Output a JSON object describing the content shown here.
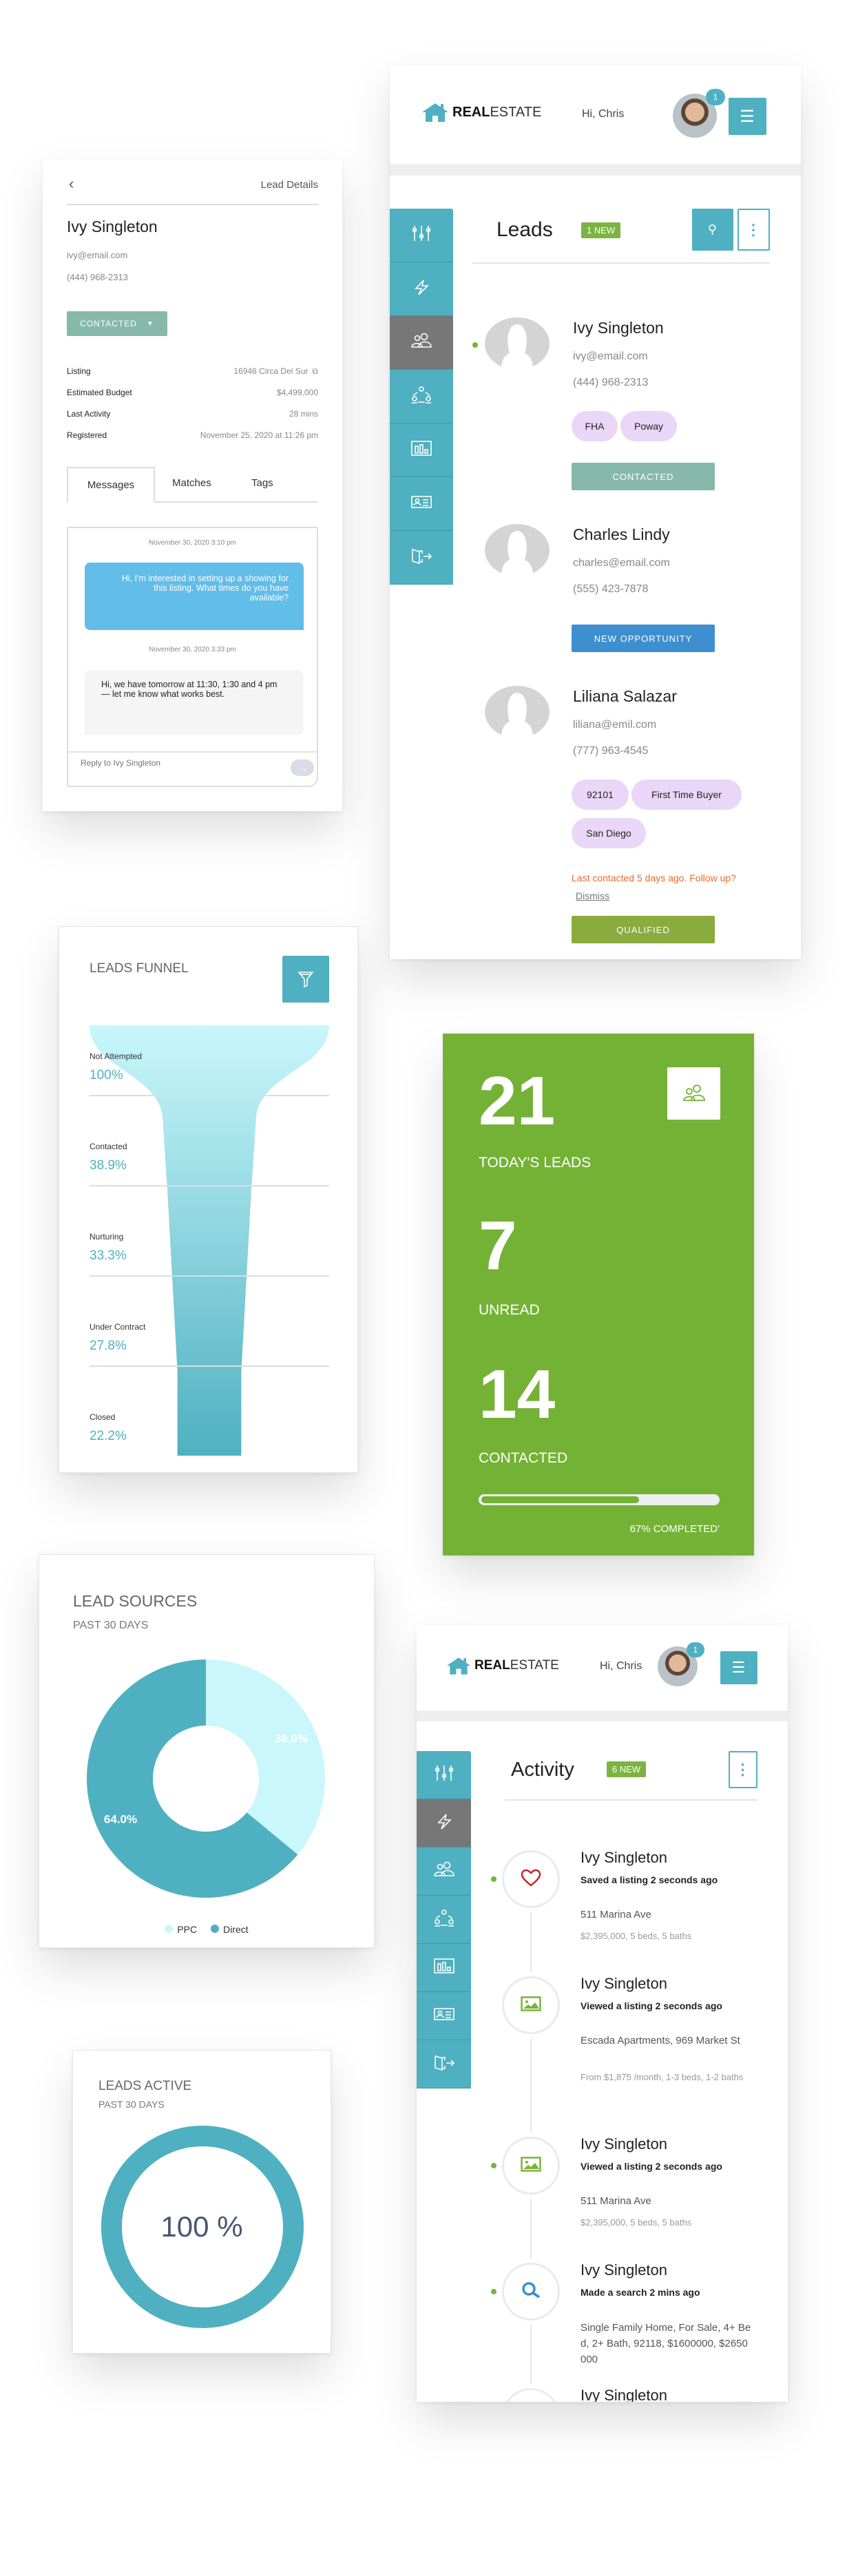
{
  "lead_details": {
    "title": "Lead Details",
    "name": "Ivy Singleton",
    "email": "ivy@email.com",
    "phone": "(444) 968-2313",
    "status": "CONTACTED",
    "fields": [
      {
        "label": "Listing",
        "value": "16946 Circa Del Sur"
      },
      {
        "label": "Estimated Budget",
        "value": "$4,499,000"
      },
      {
        "label": "Last Activity",
        "value": "28 mins"
      },
      {
        "label": "Registered",
        "value": "November 25, 2020 at 11:26 pm"
      }
    ],
    "tabs": [
      "Messages",
      "Matches",
      "Tags"
    ],
    "active_tab": "Messages",
    "messages": [
      {
        "time": "November 30, 2020 3:10 pm",
        "text": "Hi, I'm interested in setting up a showing for this listing. What times do you have available?",
        "outgoing": true
      },
      {
        "time": "November 30, 2020 3:33 pm",
        "text": "Hi, we have tomorrow at 11:30, 1:30 and 4 pm — let me know what works best.",
        "outgoing": false
      }
    ],
    "reply_placeholder": "Reply to Ivy Singleton"
  },
  "header": {
    "logo_bold": "REAL",
    "logo_light": "ESTATE",
    "greeting": "Hi, Chris",
    "notification_count": "1"
  },
  "sidebar_icons": [
    "sliders-icon",
    "bolt-icon",
    "users-icon",
    "network-icon",
    "chart-icon",
    "id-card-icon",
    "logout-icon"
  ],
  "leads": {
    "title": "Leads",
    "badge": "1 NEW",
    "items": [
      {
        "name": "Ivy Singleton",
        "email": "ivy@email.com",
        "phone": "(444) 968-2313",
        "tags": [
          "FHA",
          "Poway"
        ],
        "status": "CONTACTED",
        "status_color": "#86b9a9",
        "unread": true
      },
      {
        "name": "Charles Lindy",
        "email": "charles@email.com",
        "phone": "(555) 423-7878",
        "tags": [],
        "status": "NEW OPPORTUNITY",
        "status_color": "#3e8fd0",
        "unread": false
      },
      {
        "name": "Liliana Salazar",
        "email": "liliana@emil.com",
        "phone": "(777) 963-4545",
        "tags": [
          "92101",
          "First Time Buyer",
          "San Diego"
        ],
        "warning": "Last contacted 5 days ago. Follow up?",
        "dismiss": "Dismiss",
        "status": "QUALIFIED",
        "status_color": "#8aab3e",
        "unread": false
      }
    ]
  },
  "funnel": {
    "title": "LEADS FUNNEL",
    "chart_data": {
      "type": "funnel",
      "categories": [
        "Not Attempted",
        "Contacted",
        "Nurturing",
        "Under Contract",
        "Closed"
      ],
      "values": [
        100,
        38.9,
        33.3,
        27.8,
        22.2
      ],
      "labels": [
        "100%",
        "38.9%",
        "33.3%",
        "27.8%",
        "22.2%"
      ],
      "colors": [
        "#c9f7fb",
        "#4fb0c1"
      ]
    }
  },
  "stats": {
    "todays_leads": "21",
    "todays_leads_label": "TODAY'S LEADS",
    "unread": "7",
    "unread_label": "UNREAD",
    "contacted": "14",
    "contacted_label": "CONTACTED",
    "progress": 0.67,
    "progress_label": "67% COMPLETED'",
    "color": "#74b236"
  },
  "lead_sources": {
    "title": "LEAD SOURCES",
    "subtitle": "PAST 30 DAYS",
    "chart_data": {
      "type": "pie",
      "donut": true,
      "categories": [
        "PPC",
        "Direct"
      ],
      "values": [
        36.0,
        64.0
      ],
      "labels": [
        "36.0%",
        "64.0%"
      ],
      "colors": [
        "#c9f7fb",
        "#4fb0c1"
      ],
      "legend": "bottom"
    }
  },
  "leads_active": {
    "title": "LEADS ACTIVE",
    "subtitle": "PAST 30 DAYS",
    "value": 100,
    "label": "100 %"
  },
  "activity": {
    "title": "Activity",
    "badge": "6 NEW",
    "items": [
      {
        "icon": "heart-icon",
        "name": "Ivy Singleton",
        "action": "Saved a listing 2 seconds ago",
        "address": "511 Marina Ave",
        "detail": "$2,395,000, 5 beds, 5 baths",
        "unread": true
      },
      {
        "icon": "image-icon",
        "name": "Ivy Singleton",
        "action": "Viewed a listing 2 seconds ago",
        "address": "Escada Apartments, 969 Market St",
        "detail": "From $1,875 /month, 1-3 beds, 1-2 baths",
        "unread": false
      },
      {
        "icon": "image-icon",
        "name": "Ivy Singleton",
        "action": "Viewed a listing 2 seconds ago",
        "address": "511 Marina Ave",
        "detail": "$2,395,000, 5 beds, 5 baths",
        "unread": true
      },
      {
        "icon": "search-icon",
        "name": "Ivy Singleton",
        "action": "Made a search 2 mins ago",
        "address": "Single Family Home, For Sale, 4+ Bed, 2+ Bath, 92118, $1600000, $2650000",
        "detail": "",
        "unread": true
      },
      {
        "icon": "image-icon",
        "name": "Ivy Singleton",
        "action": "",
        "address": "",
        "detail": "",
        "unread": false
      }
    ]
  }
}
